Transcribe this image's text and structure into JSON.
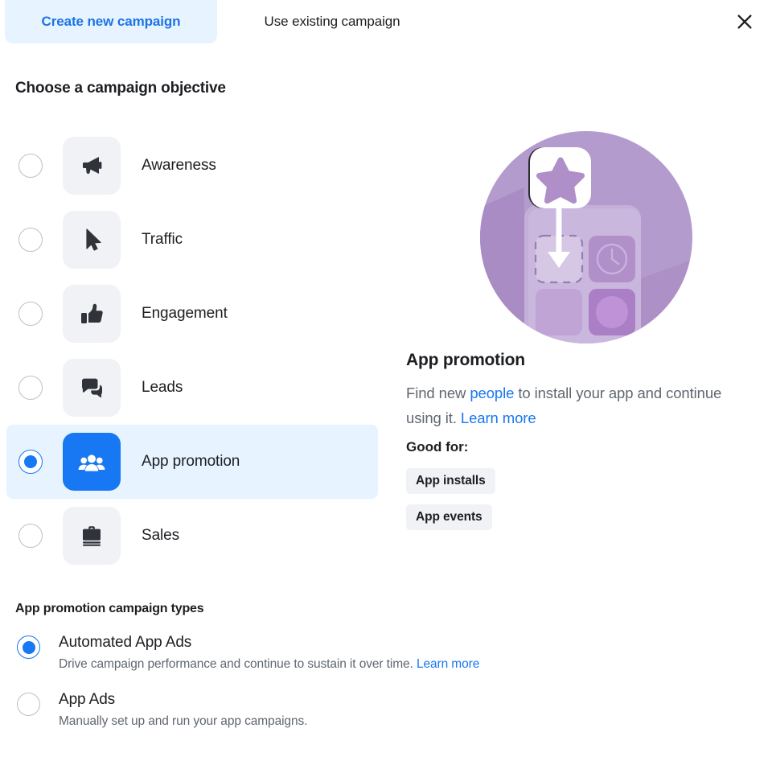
{
  "tabs": [
    {
      "label": "Create new campaign",
      "active": true
    },
    {
      "label": "Use existing campaign",
      "active": false
    }
  ],
  "close_icon": "close-icon",
  "objective_section": {
    "heading": "Choose a campaign objective",
    "items": [
      {
        "label": "Awareness",
        "icon": "megaphone-icon",
        "selected": false
      },
      {
        "label": "Traffic",
        "icon": "cursor-icon",
        "selected": false
      },
      {
        "label": "Engagement",
        "icon": "thumbs-up-icon",
        "selected": false
      },
      {
        "label": "Leads",
        "icon": "chat-bubbles-icon",
        "selected": false
      },
      {
        "label": "App promotion",
        "icon": "people-icon",
        "selected": true
      },
      {
        "label": "Sales",
        "icon": "briefcase-icon",
        "selected": false
      }
    ]
  },
  "detail": {
    "illustration": "app-install-illustration",
    "title": "App promotion",
    "desc_part1": "Find new ",
    "desc_link1": "people",
    "desc_part2": " to install your app and continue using it. ",
    "desc_link2": "Learn more",
    "good_for_label": "Good for:",
    "pills": [
      "App installs",
      "App events"
    ]
  },
  "types_section": {
    "heading": "App promotion campaign types",
    "items": [
      {
        "title": "Automated App Ads",
        "desc": "Drive campaign performance and continue to sustain it over time. ",
        "link": "Learn more",
        "selected": true
      },
      {
        "title": "App Ads",
        "desc": "Manually set up and run your app campaigns.",
        "link": "",
        "selected": false
      }
    ]
  },
  "colors": {
    "accent_blue": "#1877f2",
    "tab_active_bg": "#e7f3ff",
    "tile_bg": "#f0f2f5",
    "text_primary": "#1c1e21",
    "text_secondary": "#606770",
    "illustration_purple": "#b39ccb"
  }
}
